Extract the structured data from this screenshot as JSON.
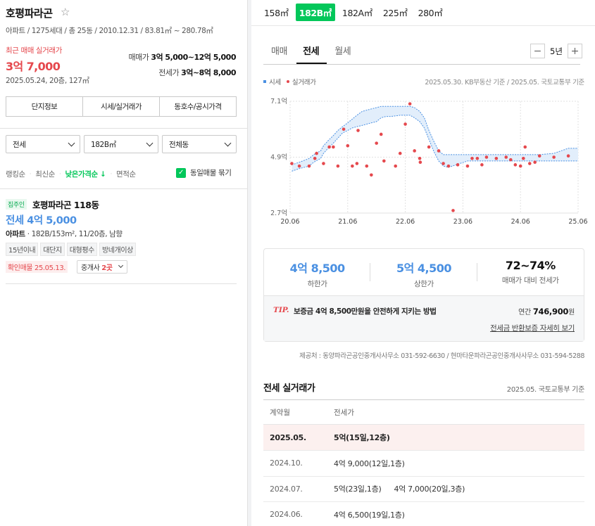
{
  "complex": {
    "name": "호평파라곤",
    "star": "☆",
    "meta": "아파트 / 1275세대 / 총 25동 / 2010.12.31 / 83.81㎡ ~ 280.78㎡"
  },
  "recent_sale": {
    "label": "최근 매매 실거래가",
    "price": "3억 7,000",
    "detail": "2025.05.24, 20층, 127㎡"
  },
  "ranges": {
    "sale_label": "매매가",
    "sale_value": "3억 5,000~12억 5,000",
    "jeonse_label": "전세가",
    "jeonse_value": "3억~8억 8,000"
  },
  "info_tabs": [
    "단지정보",
    "시세/실거래가",
    "동호수/공시가격"
  ],
  "filters": {
    "trade_type": "전세",
    "area": "182B㎡",
    "dong": "전체동"
  },
  "sort": {
    "options": [
      "랭킹순",
      "최신순",
      "낮은가격순 ↓",
      "면적순"
    ],
    "active_index": 2,
    "group_label": "동일매물 묶기",
    "group_checked": true
  },
  "listing": {
    "badge": "집주인",
    "title": "호평파라곤 118동",
    "price": "전세 4억 5,000",
    "spec_type": "아파트",
    "spec_rest": " · 182B/153m², 11/20층, 남향",
    "tags": [
      "15년이내",
      "대단지",
      "대형평수",
      "방네개이상"
    ],
    "confirmed": "확인매물 25.05.13.",
    "agent_label": "중개사",
    "agent_count": "2곳"
  },
  "area_tabs": [
    "158㎡",
    "182B㎡",
    "182A㎡",
    "225㎡",
    "280㎡"
  ],
  "area_active": 1,
  "trade_tabs": [
    "매매",
    "전세",
    "월세"
  ],
  "trade_active": 1,
  "period": {
    "minus": "−",
    "value": "5년",
    "plus": "+"
  },
  "legend": {
    "market": "시세",
    "actual": "실거래가"
  },
  "chart_source": "2025.05.30. KB부동산 기준 / 2025.05. 국토교통부 기준",
  "chart_data": {
    "type": "line",
    "y_ticks": [
      "7.1억",
      "4.9억",
      "2.7억"
    ],
    "y_tick_values": [
      7.1,
      4.9,
      2.7
    ],
    "x_ticks": [
      "20.06",
      "21.06",
      "22.06",
      "23.06",
      "24.06",
      "25.06"
    ],
    "x_tick_values": [
      2020.42,
      2021.42,
      2022.42,
      2023.42,
      2024.42,
      2025.42
    ],
    "ylim": [
      2.7,
      7.1
    ],
    "xlim": [
      2020.42,
      2025.42
    ],
    "grid": true,
    "series": [
      {
        "name": "시세",
        "kind": "band",
        "x": [
          2020.45,
          2020.58,
          2020.75,
          2020.83,
          2020.95,
          2021.0,
          2021.08,
          2021.17,
          2021.25,
          2021.33,
          2021.42,
          2021.5,
          2021.58,
          2021.67,
          2021.75,
          2021.83,
          2021.92,
          2022.0,
          2022.08,
          2022.17,
          2022.33,
          2022.42,
          2022.5,
          2022.58,
          2022.67,
          2022.75,
          2022.83,
          2022.92,
          2023.0,
          2023.08,
          2023.17,
          2023.5,
          2023.75,
          2024.0,
          2024.25,
          2024.42,
          2024.67,
          2024.75,
          2025.0,
          2025.25,
          2025.42
        ],
        "low": [
          4.35,
          4.45,
          4.55,
          4.7,
          4.85,
          5.05,
          5.25,
          5.45,
          5.65,
          5.85,
          5.95,
          6.05,
          6.1,
          6.15,
          6.2,
          6.25,
          6.3,
          6.45,
          6.5,
          6.5,
          6.55,
          6.55,
          6.55,
          6.45,
          6.3,
          6.05,
          5.6,
          5.1,
          4.75,
          4.55,
          4.5,
          4.75,
          4.75,
          4.75,
          4.75,
          4.75,
          4.75,
          4.75,
          4.75,
          4.75,
          4.75
        ],
        "high": [
          4.6,
          4.7,
          4.85,
          5.0,
          5.15,
          5.35,
          5.55,
          5.75,
          5.95,
          6.1,
          6.25,
          6.4,
          6.55,
          6.7,
          6.75,
          6.8,
          6.85,
          6.9,
          6.9,
          6.9,
          6.9,
          6.9,
          6.9,
          6.85,
          6.7,
          6.45,
          5.95,
          5.5,
          5.15,
          5.0,
          5.0,
          5.0,
          5.0,
          5.0,
          5.0,
          5.0,
          5.0,
          5.0,
          5.05,
          5.25,
          5.25
        ]
      },
      {
        "name": "실거래가",
        "kind": "scatter",
        "points": [
          [
            2020.45,
            4.65
          ],
          [
            2020.58,
            4.55
          ],
          [
            2020.75,
            4.55
          ],
          [
            2020.85,
            4.85
          ],
          [
            2020.88,
            5.05
          ],
          [
            2021.0,
            4.65
          ],
          [
            2021.1,
            5.3
          ],
          [
            2021.17,
            5.3
          ],
          [
            2021.25,
            4.55
          ],
          [
            2021.35,
            6.0
          ],
          [
            2021.42,
            5.35
          ],
          [
            2021.5,
            4.55
          ],
          [
            2021.58,
            4.65
          ],
          [
            2021.6,
            5.95
          ],
          [
            2021.75,
            4.55
          ],
          [
            2021.83,
            4.2
          ],
          [
            2021.92,
            5.45
          ],
          [
            2022.0,
            5.8
          ],
          [
            2022.05,
            4.75
          ],
          [
            2022.25,
            4.55
          ],
          [
            2022.33,
            5.05
          ],
          [
            2022.42,
            6.2
          ],
          [
            2022.5,
            7.0
          ],
          [
            2022.58,
            5.15
          ],
          [
            2022.67,
            4.85
          ],
          [
            2022.68,
            4.7
          ],
          [
            2022.83,
            5.3
          ],
          [
            2023.0,
            5.15
          ],
          [
            2023.08,
            4.65
          ],
          [
            2023.17,
            4.55
          ],
          [
            2023.25,
            2.8
          ],
          [
            2023.33,
            4.6
          ],
          [
            2023.5,
            4.55
          ],
          [
            2023.58,
            4.85
          ],
          [
            2023.67,
            4.85
          ],
          [
            2023.75,
            4.6
          ],
          [
            2023.83,
            4.9
          ],
          [
            2024.0,
            4.85
          ],
          [
            2024.17,
            4.9
          ],
          [
            2024.25,
            4.8
          ],
          [
            2024.33,
            4.6
          ],
          [
            2024.42,
            4.55
          ],
          [
            2024.47,
            4.85
          ],
          [
            2024.5,
            5.3
          ],
          [
            2024.58,
            4.65
          ],
          [
            2024.67,
            4.7
          ],
          [
            2024.75,
            4.95
          ],
          [
            2025.0,
            4.9
          ],
          [
            2025.25,
            4.95
          ]
        ]
      }
    ]
  },
  "summary": {
    "low_value": "4억 8,500",
    "low_label": "하한가",
    "high_value": "5억 4,500",
    "high_label": "상한가",
    "ratio_value": "72~74%",
    "ratio_label": "매매가 대비 전세가"
  },
  "tip": {
    "badge": "TIP.",
    "text": "보증금 4억 8,500만원을 안전하게 지키는 방법",
    "year_label": "연간",
    "year_value": "746,900",
    "year_unit": "원",
    "link": "전세금 반환보증 자세히 보기"
  },
  "provider": "제공처 : 동양파라곤공인중개사사무소 031-592-6630 / 현마타운파라곤공인중개사사무소 031-594-5288",
  "real_trades": {
    "title": "전세 실거래가",
    "source": "2025.05. 국토교통부 기준",
    "headers": [
      "계약월",
      "전세가"
    ],
    "rows": [
      {
        "month": "2025.05.",
        "prices": [
          "5억(15일,12층)"
        ],
        "highlight": true
      },
      {
        "month": "2024.10.",
        "prices": [
          "4억 9,000(12일,1층)"
        ],
        "highlight": false
      },
      {
        "month": "2024.07.",
        "prices": [
          "5억(23일,1층)",
          "4억 7,000(20일,3층)"
        ],
        "highlight": false
      },
      {
        "month": "2024.06.",
        "prices": [
          "4억 6,500(19일,1층)"
        ],
        "highlight": false
      }
    ]
  }
}
